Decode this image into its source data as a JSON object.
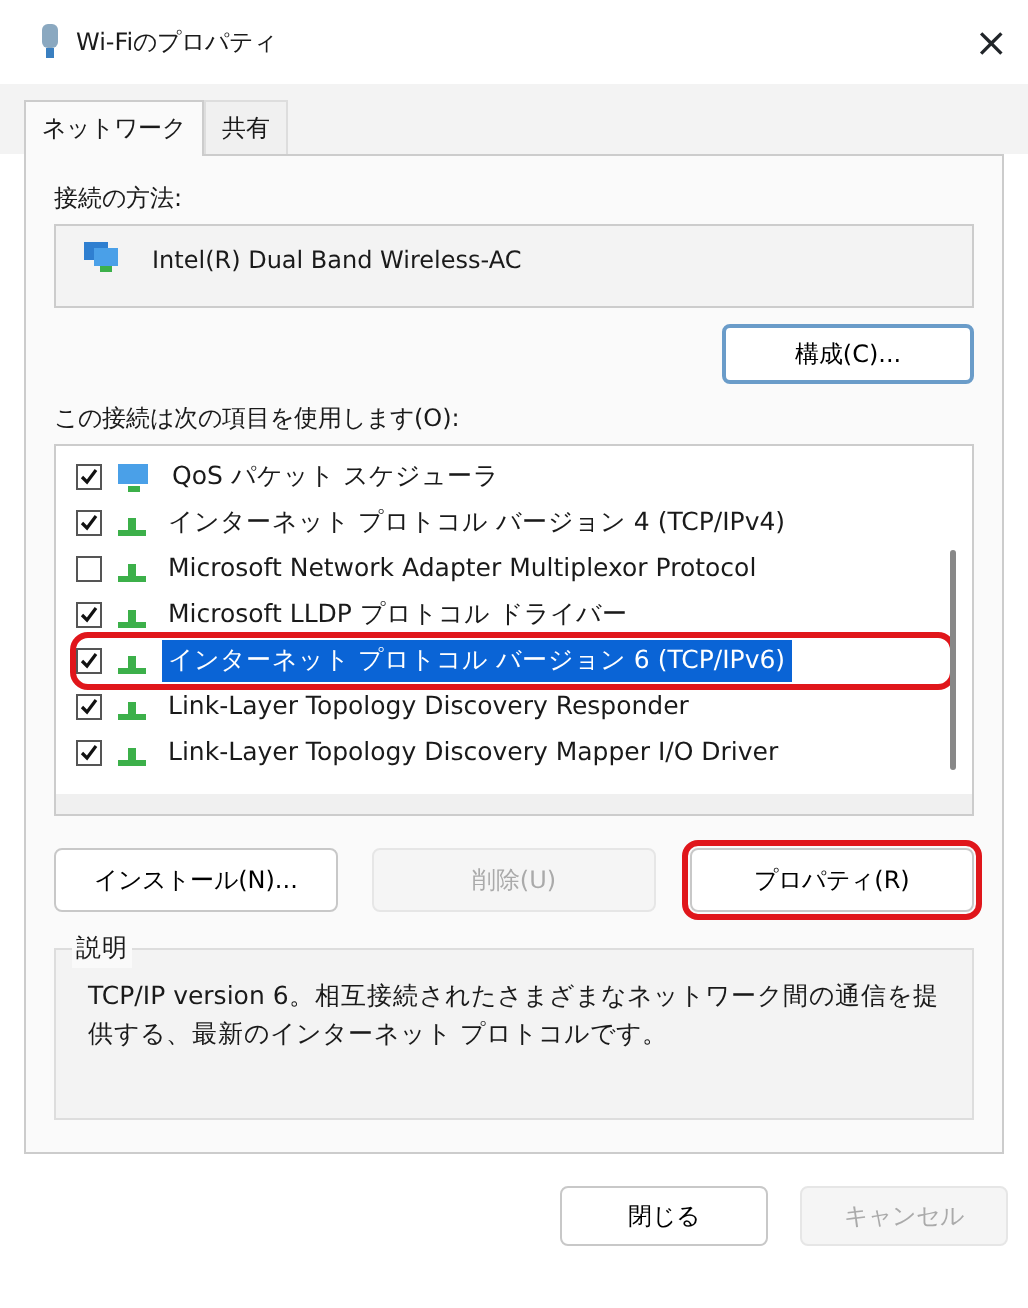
{
  "window": {
    "title": "Wi-Fiのプロパティ",
    "close": "×"
  },
  "tabs": [
    {
      "label": "ネットワーク",
      "selected": true
    },
    {
      "label": "共有",
      "selected": false
    }
  ],
  "connect_using": {
    "label": "接続の方法:",
    "adapter": "Intel(R) Dual Band Wireless-AC",
    "configure_button": "構成(C)..."
  },
  "items_label": "この接続は次の項目を使用します(O):",
  "items": [
    {
      "kind": "scheduler",
      "label": "QoS パケット スケジューラ",
      "checked": true,
      "selected": false,
      "highlighted": false
    },
    {
      "kind": "protocol",
      "label": "インターネット プロトコル バージョン 4 (TCP/IPv4)",
      "checked": true,
      "selected": false,
      "highlighted": false
    },
    {
      "kind": "protocol",
      "label": "Microsoft Network Adapter Multiplexor Protocol",
      "checked": false,
      "selected": false,
      "highlighted": false
    },
    {
      "kind": "protocol",
      "label": "Microsoft LLDP プロトコル ドライバー",
      "checked": true,
      "selected": false,
      "highlighted": false
    },
    {
      "kind": "protocol",
      "label": "インターネット プロトコル バージョン 6 (TCP/IPv6)",
      "checked": true,
      "selected": true,
      "highlighted": true
    },
    {
      "kind": "protocol",
      "label": "Link-Layer Topology Discovery Responder",
      "checked": true,
      "selected": false,
      "highlighted": false
    },
    {
      "kind": "protocol",
      "label": "Link-Layer Topology Discovery Mapper I/O Driver",
      "checked": true,
      "selected": false,
      "highlighted": false
    }
  ],
  "item_buttons": [
    {
      "label": "インストール(N)...",
      "disabled": false,
      "highlighted": false
    },
    {
      "label": "削除(U)",
      "disabled": true,
      "highlighted": false
    },
    {
      "label": "プロパティ(R)",
      "disabled": false,
      "highlighted": true
    }
  ],
  "description": {
    "label": "説明",
    "text": "TCP/IP version 6。相互接続されたさまざまなネットワーク間の通信を提供する、最新のインターネット プロトコルです。"
  },
  "footer_buttons": [
    {
      "label": "閉じる",
      "disabled": false
    },
    {
      "label": "キャンセル",
      "disabled": true
    }
  ]
}
